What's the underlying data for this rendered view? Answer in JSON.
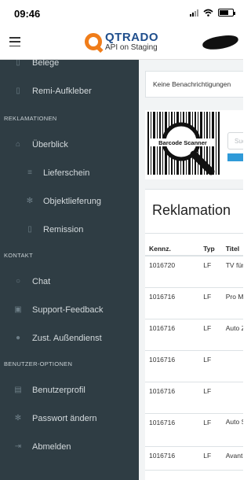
{
  "status_bar": {
    "time": "09:46"
  },
  "header": {
    "brand": "QTRADO",
    "subtitle": "API on Staging"
  },
  "sidebar": {
    "items": [
      {
        "label": "Belege",
        "icon": "document-icon"
      },
      {
        "label": "Remi-Aufkleber",
        "icon": "document-icon"
      },
      {
        "section": "REKLAMATIONEN"
      },
      {
        "label": "Überblick",
        "icon": "home-icon"
      },
      {
        "label": "Lieferschein",
        "icon": "list-icon"
      },
      {
        "label": "Objektlieferung",
        "icon": "gear-icon"
      },
      {
        "label": "Remission",
        "icon": "document-icon"
      },
      {
        "section": "KONTAKT"
      },
      {
        "label": "Chat",
        "icon": "chat-icon"
      },
      {
        "label": "Support-Feedback",
        "icon": "support-icon"
      },
      {
        "label": "Zust. Außendienst",
        "icon": "person-icon"
      },
      {
        "section": "BENUTZER-OPTIONEN"
      },
      {
        "label": "Benutzerprofil",
        "icon": "id-card-icon"
      },
      {
        "label": "Passwort ändern",
        "icon": "gear-icon"
      },
      {
        "label": "Abmelden",
        "icon": "logout-icon"
      }
    ]
  },
  "main": {
    "notice": "Keine Benachrichtigungen",
    "scanner": {
      "logo_text": "Barcode Scanner",
      "input_placeholder": "Suchen"
    },
    "panel_title": "Reklamation",
    "table": {
      "headers": [
        "Kennz.",
        "Typ",
        "Titel"
      ],
      "rows": [
        {
          "kennz": "1016720",
          "typ": "LF",
          "titel": "TV für Mich"
        },
        {
          "kennz": "1016716",
          "typ": "LF",
          "titel": "Pro Mobil"
        },
        {
          "kennz": "1016716",
          "typ": "LF",
          "titel": "Auto Zeitung"
        },
        {
          "kennz": "1016716",
          "typ": "LF",
          "titel": ""
        },
        {
          "kennz": "1016716",
          "typ": "LF",
          "titel": ""
        },
        {
          "kennz": "1016716",
          "typ": "LF",
          "titel": "Auto Strasse"
        },
        {
          "kennz": "1016716",
          "typ": "LF",
          "titel": "Avanti"
        }
      ]
    }
  },
  "colors": {
    "sidebar_bg": "#2f3d44",
    "accent_blue": "#2f9ad8",
    "brand_orange": "#f07d1a",
    "brand_blue": "#1f4e8c"
  }
}
